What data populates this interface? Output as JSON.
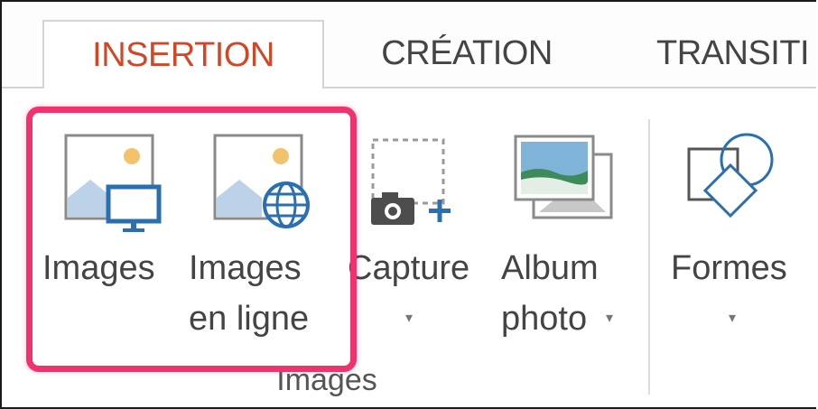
{
  "tabs": [
    {
      "label": "INSERTION",
      "active": true
    },
    {
      "label": "CRÉATION",
      "active": false
    },
    {
      "label": "TRANSITI",
      "active": false
    }
  ],
  "ribbon": {
    "buttons": {
      "images": {
        "line1": "Images",
        "icon": "picture-monitor-icon"
      },
      "images_online": {
        "line1": "Images",
        "line2": "en ligne",
        "icon": "picture-globe-icon"
      },
      "capture": {
        "line1": "Capture",
        "dropdown": "▾",
        "icon": "camera-capture-icon"
      },
      "album": {
        "line1": "Album",
        "line2": "photo",
        "dropdown": "▾",
        "icon": "photo-album-icon"
      },
      "formes": {
        "line1": "Formes",
        "dropdown": "▾",
        "icon": "shapes-icon"
      }
    },
    "group_label": "Images"
  },
  "colors": {
    "active_tab_text": "#d24726",
    "highlight": "#f0336f",
    "icon_blue": "#2a6fb0",
    "icon_sun": "#f2c36b"
  }
}
